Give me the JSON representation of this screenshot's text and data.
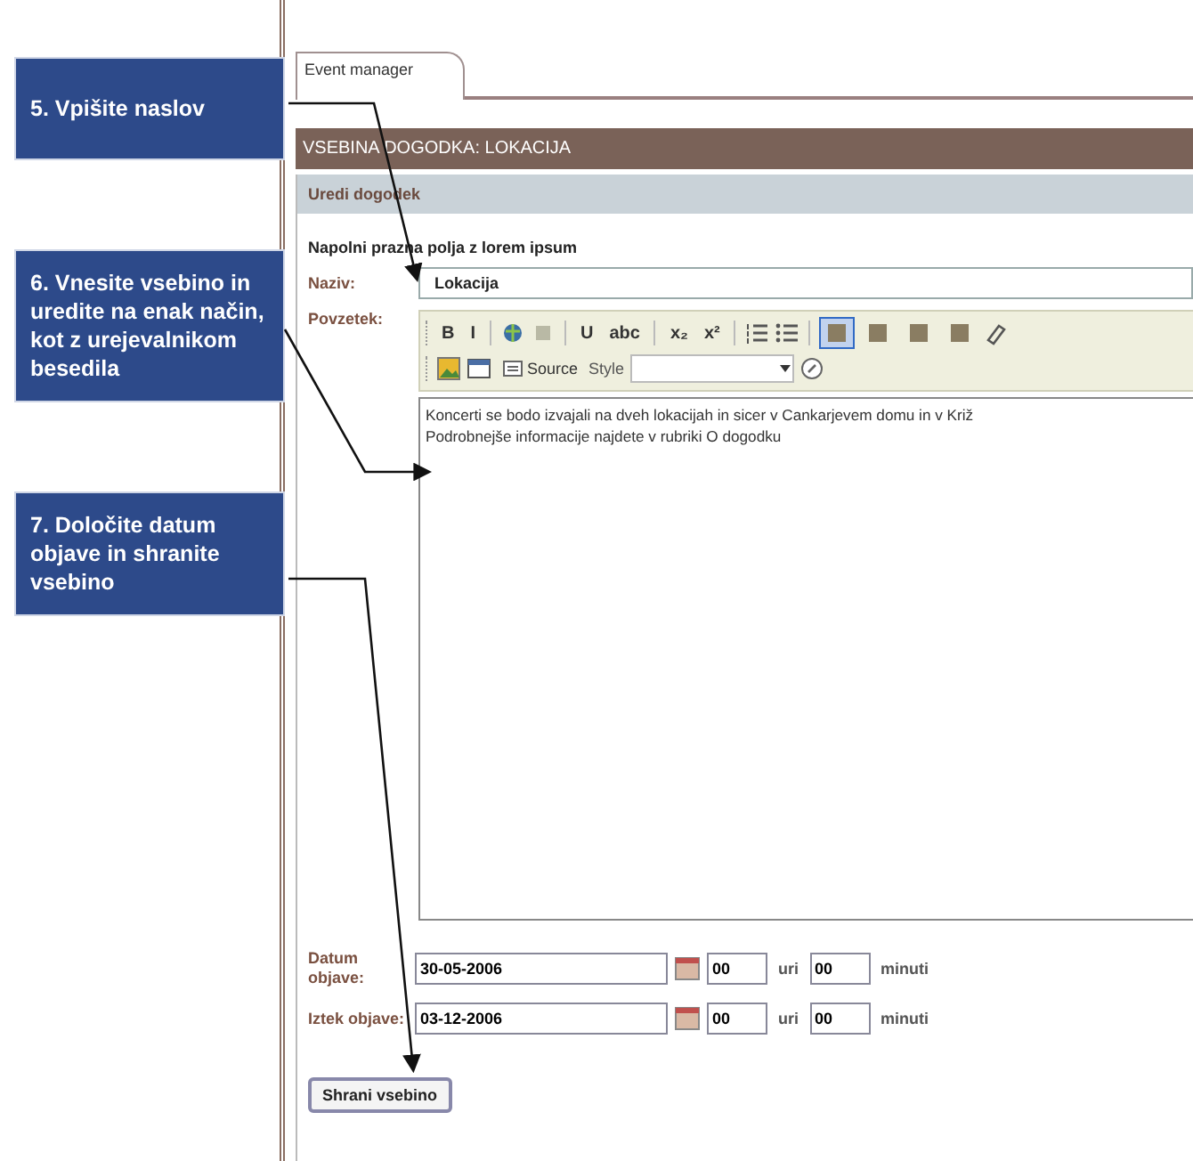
{
  "callouts": [
    {
      "text": "5. Vpišite naslov"
    },
    {
      "text": "6. Vnesite vsebino in uredite na enak način, kot z urejevalnikom besedila"
    },
    {
      "text": "7. Določite datum objave in shranite vsebino"
    }
  ],
  "tabs": [
    {
      "label": "Event manager",
      "selected": true
    }
  ],
  "header": "VSEBINA DOGODKA: LOKACIJA",
  "panel_title": "Uredi dogodek",
  "fill_link": "Napolni prazna polja z lorem ipsum",
  "title_field": {
    "label": "Naziv:",
    "value": "Lokacija"
  },
  "summary_label": "Povzetek:",
  "toolbar_rows": [
    [
      {
        "kind": "glyph",
        "text": "B"
      },
      {
        "kind": "glyph",
        "text": "I"
      },
      {
        "kind": "sep"
      },
      {
        "kind": "link"
      },
      {
        "kind": "unlink"
      },
      {
        "kind": "sep"
      },
      {
        "kind": "glyph",
        "text": "U"
      },
      {
        "kind": "glyph",
        "text": "abc"
      },
      {
        "kind": "sep"
      },
      {
        "kind": "glyph",
        "text": "x₂"
      },
      {
        "kind": "glyph",
        "text": "x²"
      },
      {
        "kind": "sep"
      },
      {
        "kind": "ol"
      },
      {
        "kind": "ul"
      },
      {
        "kind": "sep"
      },
      {
        "kind": "align",
        "selected": true
      },
      {
        "kind": "align",
        "selected": false
      },
      {
        "kind": "align",
        "selected": false
      },
      {
        "kind": "align",
        "selected": false
      },
      {
        "kind": "eraser"
      }
    ],
    [
      {
        "kind": "image"
      },
      {
        "kind": "table"
      },
      {
        "kind": "source",
        "text": "Source"
      },
      {
        "kind": "label",
        "text": "Style"
      },
      {
        "kind": "select"
      },
      {
        "kind": "help"
      }
    ]
  ],
  "editor_text": [
    "Koncerti se bodo izvajali na dveh lokacijah in sicer v Cankarjevem domu in v Križ",
    "Podrobnejše informacije najdete v rubriki O dogodku"
  ],
  "date_rows": [
    {
      "label": "Datum objave:",
      "date": "30-05-2006",
      "hour": "00",
      "hour_unit": "uri",
      "minute": "00",
      "minute_unit": "minuti"
    },
    {
      "label": "Iztek objave:",
      "date": "03-12-2006",
      "hour": "00",
      "hour_unit": "uri",
      "minute": "00",
      "minute_unit": "minuti"
    }
  ],
  "save_button": "Shrani vsebino"
}
